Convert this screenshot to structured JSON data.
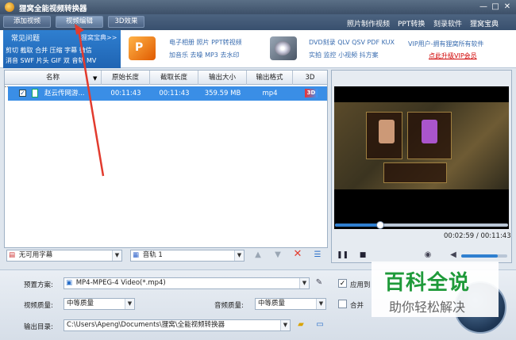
{
  "window": {
    "title": "狸窝全能视频转换器",
    "controls": [
      "—",
      "□",
      "✕"
    ]
  },
  "toolbar": {
    "buttons": [
      "添加视频",
      "视频编辑",
      "3D效果"
    ],
    "links": [
      "照片制作视频",
      "PPT转换",
      "刻录软件",
      "狸窝宝典"
    ]
  },
  "promo": {
    "faq_title": "常见问题",
    "faq_more": "狸窝宝典>>",
    "faq_line1": "剪切 截取 合并 压缩 字幕 微信",
    "faq_line2": "消音 SWF 片头 GIF 双 音轨 MV",
    "ad1_line1": "电子相册 照片 PPT转视频",
    "ad1_line2": "加音乐 去噪 MP3 去水印",
    "ad2_line1": "DVD刻录 QLV QSV PDF KUX",
    "ad2_line2": "实拍 监控 小视频 抖方案",
    "vip_line1": "VIP用户-拥有狸窝所有软件",
    "vip_line2": "点此升级VIP会员",
    "vip_color": "#d00000"
  },
  "table": {
    "headers": [
      "名称",
      "原始长度",
      "截取长度",
      "输出大小",
      "输出格式",
      "3D"
    ],
    "rows": [
      {
        "name": "赵云传网游...",
        "orig_len": "00:11:43",
        "cut_len": "00:11:43",
        "size": "359.59 MB",
        "format": "mp4",
        "three_d": "3D"
      }
    ]
  },
  "controls": {
    "subtitle": "无可用字幕",
    "audio_track": "音轨 1"
  },
  "player": {
    "time": "00:02:59 / 00:11:43",
    "progress": 0.26,
    "volume": 0.8
  },
  "settings": {
    "preset_label": "预置方案:",
    "preset_value": "MP4-MPEG-4 Video(*.mp4)",
    "video_quality_label": "视频质量:",
    "video_quality_value": "中等质量",
    "audio_quality_label": "音频质量:",
    "audio_quality_value": "中等质量",
    "output_label": "输出目录:",
    "output_value": "C:\\Users\\Apeng\\Documents\\狸窝\\全能视频转换器",
    "apply_all": "应用到",
    "merge": "合并"
  },
  "watermark": {
    "title": "百科全说",
    "subtitle": "助你轻松解决",
    "color": "#1f9a3a"
  }
}
